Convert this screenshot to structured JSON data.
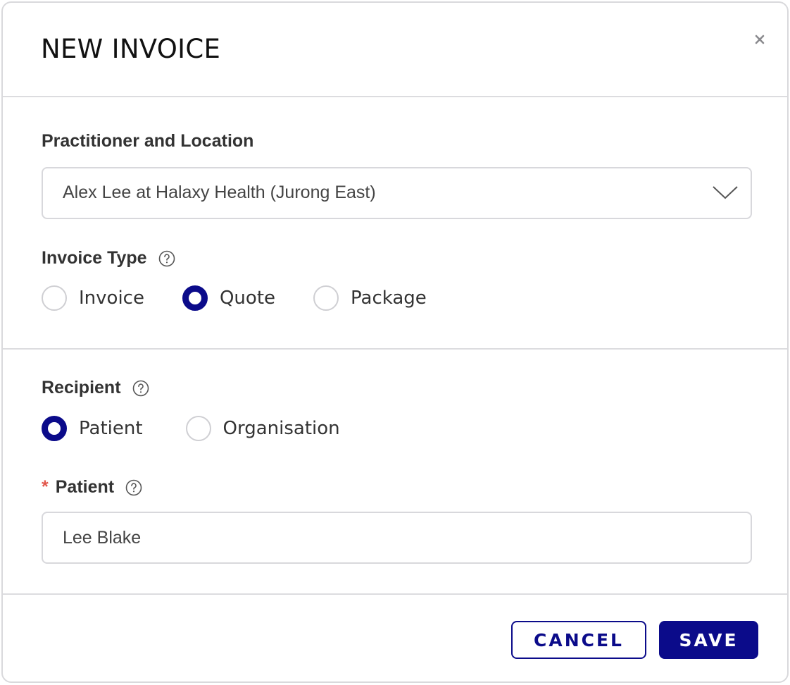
{
  "dialog": {
    "title": "NEW INVOICE",
    "close_icon": "close-icon"
  },
  "practitioner": {
    "label": "Practitioner and Location",
    "selected": "Alex Lee at Halaxy Health (Jurong East)"
  },
  "invoice_type": {
    "label": "Invoice Type",
    "options": [
      {
        "label": "Invoice",
        "checked": false
      },
      {
        "label": "Quote",
        "checked": true
      },
      {
        "label": "Package",
        "checked": false
      }
    ]
  },
  "recipient": {
    "label": "Recipient",
    "options": [
      {
        "label": "Patient",
        "checked": true
      },
      {
        "label": "Organisation",
        "checked": false
      }
    ]
  },
  "patient": {
    "required_mark": "*",
    "label": "Patient",
    "value": "Lee Blake"
  },
  "footer": {
    "cancel_label": "CANCEL",
    "save_label": "SAVE"
  },
  "colors": {
    "accent": "#0b0b8a",
    "required": "#e2574c",
    "border": "#d8d8dc"
  }
}
